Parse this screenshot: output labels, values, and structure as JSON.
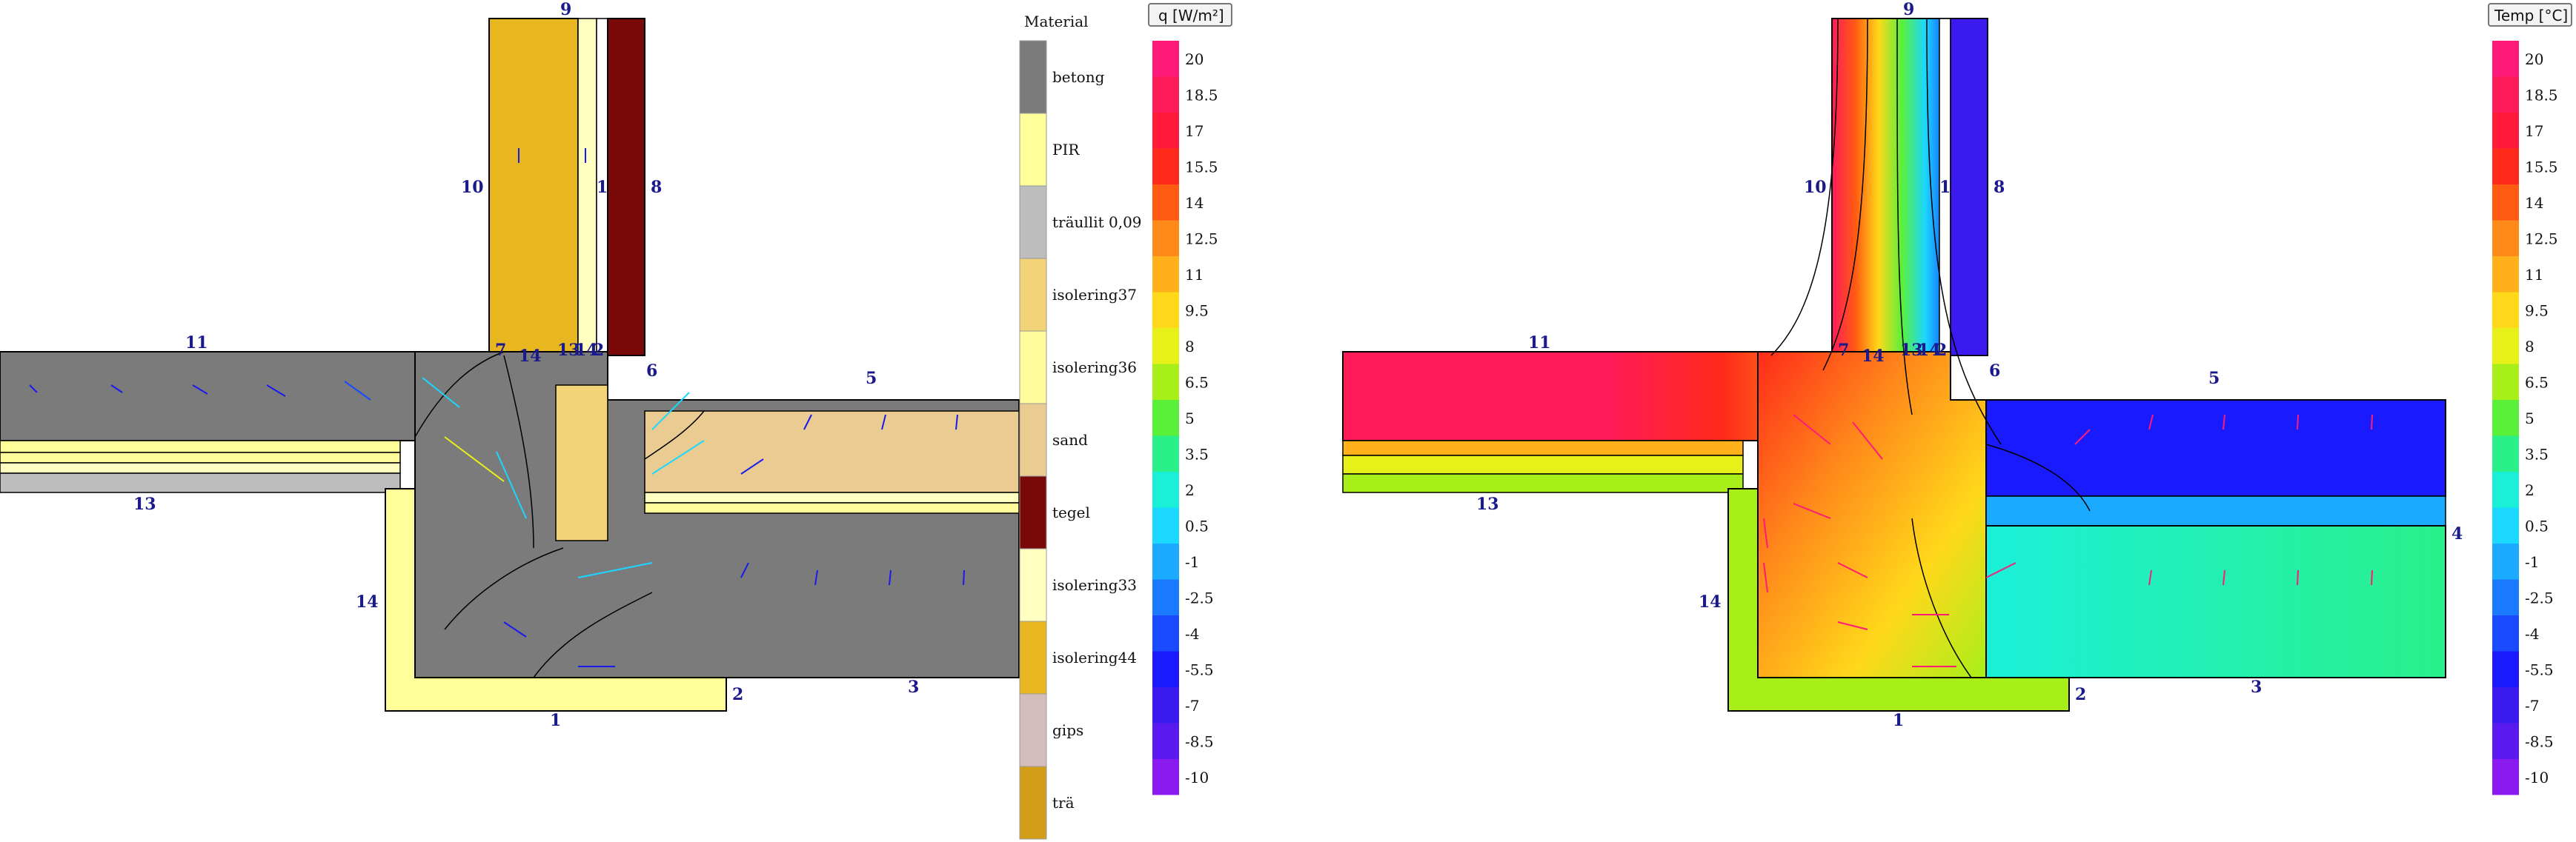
{
  "material_legend": {
    "title": "Material",
    "items": [
      {
        "name": "betong",
        "color": "#7b7b7b"
      },
      {
        "name": "PIR",
        "color": "#ffff99"
      },
      {
        "name": "träullit 0,09",
        "color": "#bdbdbd"
      },
      {
        "name": "isolering37",
        "color": "#f3d377"
      },
      {
        "name": "isolering36",
        "color": "#fffa9a"
      },
      {
        "name": "sand",
        "color": "#eacb92"
      },
      {
        "name": "tegel",
        "color": "#7a0a0a"
      },
      {
        "name": "isolering33",
        "color": "#ffffc2"
      },
      {
        "name": "isolering44",
        "color": "#e8b61e"
      },
      {
        "name": "gips",
        "color": "#d6bdbd"
      },
      {
        "name": "trä",
        "color": "#d29d18"
      }
    ]
  },
  "flux_legend": {
    "button": "q [W/m²]",
    "values": [
      "20",
      "18.5",
      "17",
      "15.5",
      "14",
      "12.5",
      "11",
      "9.5",
      "8",
      "6.5",
      "5",
      "3.5",
      "2",
      "0.5",
      "-1",
      "-2.5",
      "-4",
      "-5.5",
      "-7",
      "-8.5",
      "-10"
    ]
  },
  "temp_legend": {
    "button": "Temp [°C]",
    "values": [
      "20",
      "18.5",
      "17",
      "15.5",
      "14",
      "12.5",
      "11",
      "9.5",
      "8",
      "6.5",
      "5",
      "3.5",
      "2",
      "0.5",
      "-1",
      "-2.5",
      "-4",
      "-5.5",
      "-7",
      "-8.5",
      "-10"
    ]
  },
  "scale_colors": [
    "#ff1a7a",
    "#ff1a5a",
    "#ff1a3a",
    "#ff2a1a",
    "#ff5a12",
    "#ff8a1a",
    "#ffb01a",
    "#ffd81a",
    "#e8f01a",
    "#a8ef1a",
    "#5af03a",
    "#2af08a",
    "#1af0d8",
    "#1ad8ff",
    "#1aaaff",
    "#1a7aff",
    "#1a4aff",
    "#1a1aff",
    "#3a1aef",
    "#5a1aef",
    "#8a1aef"
  ],
  "boundary_labels_left": [
    "9",
    "10",
    "1",
    "8",
    "11",
    "7",
    "14",
    "13",
    "14",
    "2",
    "6",
    "5",
    "13",
    "14",
    "1",
    "2",
    "3"
  ],
  "boundary_labels_right": [
    "9",
    "10",
    "1",
    "8",
    "11",
    "7",
    "14",
    "13",
    "14",
    "2",
    "6",
    "5",
    "4",
    "13",
    "14",
    "1",
    "2",
    "3"
  ]
}
